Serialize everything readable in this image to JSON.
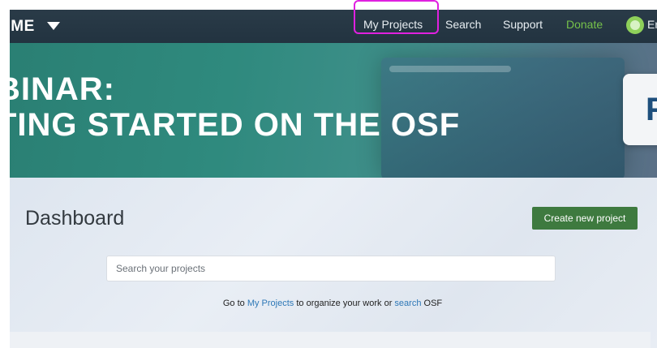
{
  "navbar": {
    "brand": "OME",
    "items": [
      {
        "label": "My Projects"
      },
      {
        "label": "Search"
      },
      {
        "label": "Support"
      },
      {
        "label": "Donate"
      }
    ],
    "user_partial": "Er",
    "colors": {
      "background": "#263947",
      "donate": "#76c24a",
      "highlight": "#e020e0"
    }
  },
  "banner": {
    "line1": "BINAR:",
    "line2": "TING STARTED ON THE OSF",
    "card_letter": "F"
  },
  "dashboard": {
    "title": "Dashboard",
    "create_button": "Create new project",
    "search_placeholder": "Search your projects",
    "goto_prefix": "Go to ",
    "goto_link1": "My Projects",
    "goto_middle": " to organize your work or ",
    "goto_link2": "search",
    "goto_suffix": " OSF"
  },
  "colors": {
    "create_button": "#3e7a3f",
    "link": "#2e78b7"
  }
}
